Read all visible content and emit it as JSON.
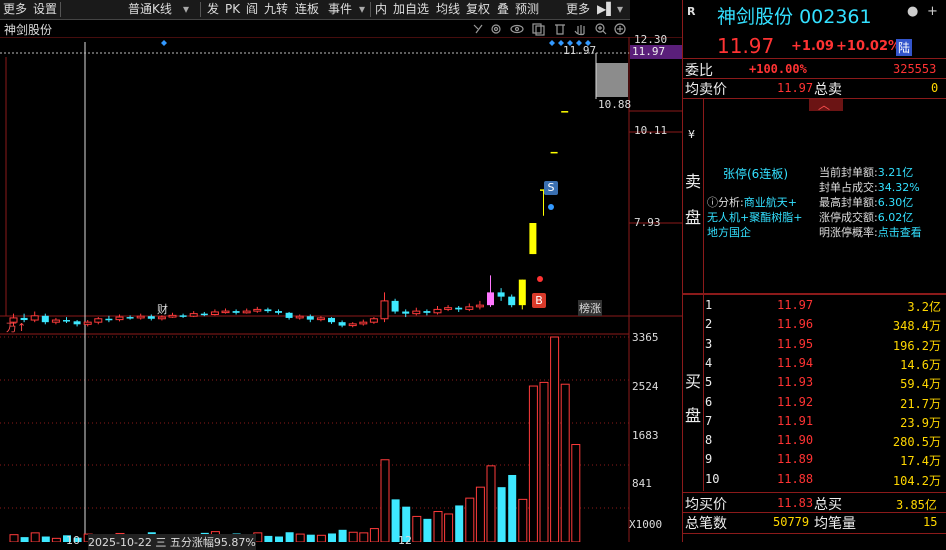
{
  "toolbar": {
    "items": [
      "更多",
      "设置",
      "普通K线",
      "▾",
      "发",
      "PK",
      "阎",
      "九转",
      "连板",
      "事件",
      "▾",
      "内",
      "加自选",
      "均线",
      "复权",
      "叠",
      "预测",
      "更多",
      "▶▌",
      "▾"
    ]
  },
  "chart": {
    "stock_name": "神剑股份",
    "price_axis": [
      "12.30",
      "11.97",
      "10.11",
      "7.93"
    ],
    "current_price_tag": "11.97",
    "high_label": "11.97",
    "low_label": "10.88",
    "marker_cai": "财",
    "marker_bang": "榜涨",
    "marker_s": "S",
    "marker_b": "B",
    "volume_unit": "万",
    "volume_axis": [
      "3365",
      "2524",
      "1683",
      "841"
    ],
    "volume_multiplier": "X1000",
    "bottom_date_left": "10",
    "bottom_date_note": "2025-10-22 三 五分涨幅95.87%",
    "bottom_date_right": "12",
    "candles": [
      {
        "o": 5.6,
        "c": 5.7,
        "h": 5.8,
        "l": 5.5
      },
      {
        "o": 5.7,
        "c": 5.65,
        "h": 5.8,
        "l": 5.6
      },
      {
        "o": 5.65,
        "c": 5.75,
        "h": 5.85,
        "l": 5.6
      },
      {
        "o": 5.75,
        "c": 5.6,
        "h": 5.8,
        "l": 5.55
      },
      {
        "o": 5.6,
        "c": 5.65,
        "h": 5.7,
        "l": 5.55
      },
      {
        "o": 5.65,
        "c": 5.62,
        "h": 5.72,
        "l": 5.58
      },
      {
        "o": 5.62,
        "c": 5.55,
        "h": 5.65,
        "l": 5.5
      },
      {
        "o": 5.55,
        "c": 5.6,
        "h": 5.65,
        "l": 5.5
      },
      {
        "o": 5.6,
        "c": 5.68,
        "h": 5.72,
        "l": 5.55
      },
      {
        "o": 5.68,
        "c": 5.66,
        "h": 5.75,
        "l": 5.6
      },
      {
        "o": 5.66,
        "c": 5.72,
        "h": 5.78,
        "l": 5.62
      },
      {
        "o": 5.72,
        "c": 5.7,
        "h": 5.76,
        "l": 5.66
      },
      {
        "o": 5.7,
        "c": 5.74,
        "h": 5.8,
        "l": 5.66
      },
      {
        "o": 5.74,
        "c": 5.68,
        "h": 5.78,
        "l": 5.64
      },
      {
        "o": 5.68,
        "c": 5.72,
        "h": 5.76,
        "l": 5.64
      },
      {
        "o": 5.72,
        "c": 5.76,
        "h": 5.82,
        "l": 5.7
      },
      {
        "o": 5.76,
        "c": 5.74,
        "h": 5.8,
        "l": 5.7
      },
      {
        "o": 5.74,
        "c": 5.8,
        "h": 5.86,
        "l": 5.72
      },
      {
        "o": 5.8,
        "c": 5.78,
        "h": 5.84,
        "l": 5.74
      },
      {
        "o": 5.78,
        "c": 5.84,
        "h": 5.9,
        "l": 5.76
      },
      {
        "o": 5.84,
        "c": 5.86,
        "h": 5.92,
        "l": 5.8
      },
      {
        "o": 5.86,
        "c": 5.82,
        "h": 5.9,
        "l": 5.78
      },
      {
        "o": 5.82,
        "c": 5.86,
        "h": 5.92,
        "l": 5.8
      },
      {
        "o": 5.86,
        "c": 5.9,
        "h": 5.96,
        "l": 5.82
      },
      {
        "o": 5.9,
        "c": 5.86,
        "h": 5.94,
        "l": 5.82
      },
      {
        "o": 5.86,
        "c": 5.82,
        "h": 5.9,
        "l": 5.78
      },
      {
        "o": 5.82,
        "c": 5.7,
        "h": 5.84,
        "l": 5.66
      },
      {
        "o": 5.7,
        "c": 5.74,
        "h": 5.78,
        "l": 5.66
      },
      {
        "o": 5.74,
        "c": 5.66,
        "h": 5.78,
        "l": 5.6
      },
      {
        "o": 5.66,
        "c": 5.7,
        "h": 5.74,
        "l": 5.62
      },
      {
        "o": 5.7,
        "c": 5.6,
        "h": 5.72,
        "l": 5.56
      },
      {
        "o": 5.6,
        "c": 5.52,
        "h": 5.64,
        "l": 5.48
      },
      {
        "o": 5.52,
        "c": 5.56,
        "h": 5.6,
        "l": 5.48
      },
      {
        "o": 5.56,
        "c": 5.6,
        "h": 5.66,
        "l": 5.52
      },
      {
        "o": 5.6,
        "c": 5.68,
        "h": 5.72,
        "l": 5.56
      },
      {
        "o": 5.68,
        "c": 6.1,
        "h": 6.3,
        "l": 5.6
      },
      {
        "o": 6.1,
        "c": 5.85,
        "h": 6.15,
        "l": 5.8
      },
      {
        "o": 5.85,
        "c": 5.8,
        "h": 5.9,
        "l": 5.72
      },
      {
        "o": 5.8,
        "c": 5.86,
        "h": 5.94,
        "l": 5.76
      },
      {
        "o": 5.86,
        "c": 5.82,
        "h": 5.9,
        "l": 5.76
      },
      {
        "o": 5.82,
        "c": 5.9,
        "h": 5.98,
        "l": 5.78
      },
      {
        "o": 5.9,
        "c": 5.94,
        "h": 6.0,
        "l": 5.86
      },
      {
        "o": 5.94,
        "c": 5.9,
        "h": 5.98,
        "l": 5.84
      },
      {
        "o": 5.9,
        "c": 5.96,
        "h": 6.04,
        "l": 5.86
      },
      {
        "o": 5.96,
        "c": 6.0,
        "h": 6.1,
        "l": 5.9
      },
      {
        "o": 6.0,
        "c": 6.3,
        "h": 6.7,
        "l": 5.96
      },
      {
        "o": 6.3,
        "c": 6.2,
        "h": 6.4,
        "l": 6.1
      },
      {
        "o": 6.2,
        "c": 6.0,
        "h": 6.25,
        "l": 5.95
      },
      {
        "o": 6.0,
        "c": 6.6,
        "h": 6.6,
        "l": 5.9
      },
      {
        "o": 7.2,
        "c": 7.93,
        "h": 7.93,
        "l": 7.2
      },
      {
        "o": 8.72,
        "c": 8.72,
        "h": 8.72,
        "l": 8.1
      },
      {
        "o": 9.6,
        "c": 9.6,
        "h": 9.6,
        "l": 9.6
      },
      {
        "o": 10.56,
        "c": 10.56,
        "h": 10.56,
        "l": 10.56
      }
    ],
    "volumes": [
      120,
      80,
      150,
      90,
      60,
      110,
      70,
      130,
      95,
      100,
      140,
      85,
      120,
      160,
      90,
      110,
      130,
      100,
      150,
      170,
      120,
      140,
      110,
      150,
      100,
      90,
      160,
      130,
      120,
      110,
      140,
      200,
      160,
      150,
      220,
      1350,
      700,
      580,
      420,
      380,
      500,
      460,
      600,
      720,
      900,
      1250,
      900,
      1100,
      700,
      2560,
      2620,
      3365,
      2590,
      1600
    ]
  },
  "quote": {
    "logo": "R",
    "name": "神剑股份",
    "code": "002361",
    "price": "11.97",
    "change": "+1.09",
    "change_pct": "+10.02%",
    "tag": "陆",
    "weibi_label": "委比",
    "weibi_value": "+100.00%",
    "weibi_num": "325553",
    "junmai_label": "均卖价",
    "junmai_value": "11.97",
    "zongmai_label": "总卖",
    "zongmai_value": "0",
    "sell_label_1": "卖",
    "sell_label_2": "盘",
    "yen_mark": "¥",
    "zt_title": "张停(6连板)",
    "analysis_label": "分析:",
    "analysis_items": [
      "商业航天+",
      "无人机+聚酯树脂+",
      "地方国企"
    ],
    "fengdan_rows": [
      {
        "label": "当前封单额:",
        "value": "3.21亿"
      },
      {
        "label": "封单占成交:",
        "value": "34.32%"
      },
      {
        "label": "最高封单额:",
        "value": "6.30亿"
      },
      {
        "label": "涨停成交额:",
        "value": "6.02亿"
      },
      {
        "label": "明涨停概率:",
        "value": "点击查看"
      }
    ],
    "buy_label_1": "买",
    "buy_label_2": "盘",
    "orderbook": [
      {
        "n": "1",
        "p": "11.97",
        "v": "3.2亿"
      },
      {
        "n": "2",
        "p": "11.96",
        "v": "348.4万"
      },
      {
        "n": "3",
        "p": "11.95",
        "v": "196.2万"
      },
      {
        "n": "4",
        "p": "11.94",
        "v": "14.6万"
      },
      {
        "n": "5",
        "p": "11.93",
        "v": "59.4万"
      },
      {
        "n": "6",
        "p": "11.92",
        "v": "21.7万"
      },
      {
        "n": "7",
        "p": "11.91",
        "v": "23.9万"
      },
      {
        "n": "8",
        "p": "11.90",
        "v": "280.5万"
      },
      {
        "n": "9",
        "p": "11.89",
        "v": "17.4万"
      },
      {
        "n": "10",
        "p": "11.88",
        "v": "104.2万"
      }
    ],
    "junmaijia_label": "均买价",
    "junmaijia_value": "11.83",
    "zongmaip_label": "总买",
    "zongmaip_value": "3.85亿",
    "zongbishu_label": "总笔数",
    "zongbishu_value": "50779",
    "junbiliang_label": "均笔量",
    "junbiliang_value": "15"
  },
  "colors": {
    "up": "#ff3b3b",
    "down": "#3ee8ff",
    "limit": "#ffff00",
    "pink": "#ff77ff",
    "bg": "#000000"
  }
}
